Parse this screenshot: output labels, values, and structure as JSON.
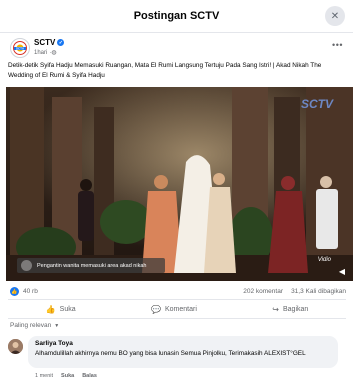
{
  "modal": {
    "title": "Postingan SCTV",
    "close_icon": "close-icon"
  },
  "post": {
    "page_name": "SCTV",
    "time": "1hari",
    "logo_text": "SCTV",
    "caption": "Detik-detik Syifa Hadju Memasuki Ruangan, Mata El Rumi Langsung Tertuju Pada Sang Istri! | Akad Nikah The Wedding of El Rumi & Syifa Hadju"
  },
  "video": {
    "subtitle": "Pengantin wanita memasuki area akad nikah",
    "watermark": "Vidio"
  },
  "stats": {
    "reactions": "40 rb",
    "comments": "202 komentar",
    "views": "31,3 Kali dibagikan"
  },
  "actions": {
    "like": "Suka",
    "comment": "Komentari",
    "share": "Bagikan"
  },
  "comments_section": {
    "sort_label": "Paling relevan"
  },
  "comment": {
    "author": "Sarliya Toya",
    "text": "Alhamdulillah akhirnya nemu BO yang bisa lunasin Semua Pinjolku, Terimakasih ALEXIST°GEL",
    "time": "1 menit",
    "like_label": "Suka",
    "reply_label": "Balas"
  },
  "colors": {
    "brand_blue": "#1877f2",
    "text_secondary": "#65676b"
  }
}
